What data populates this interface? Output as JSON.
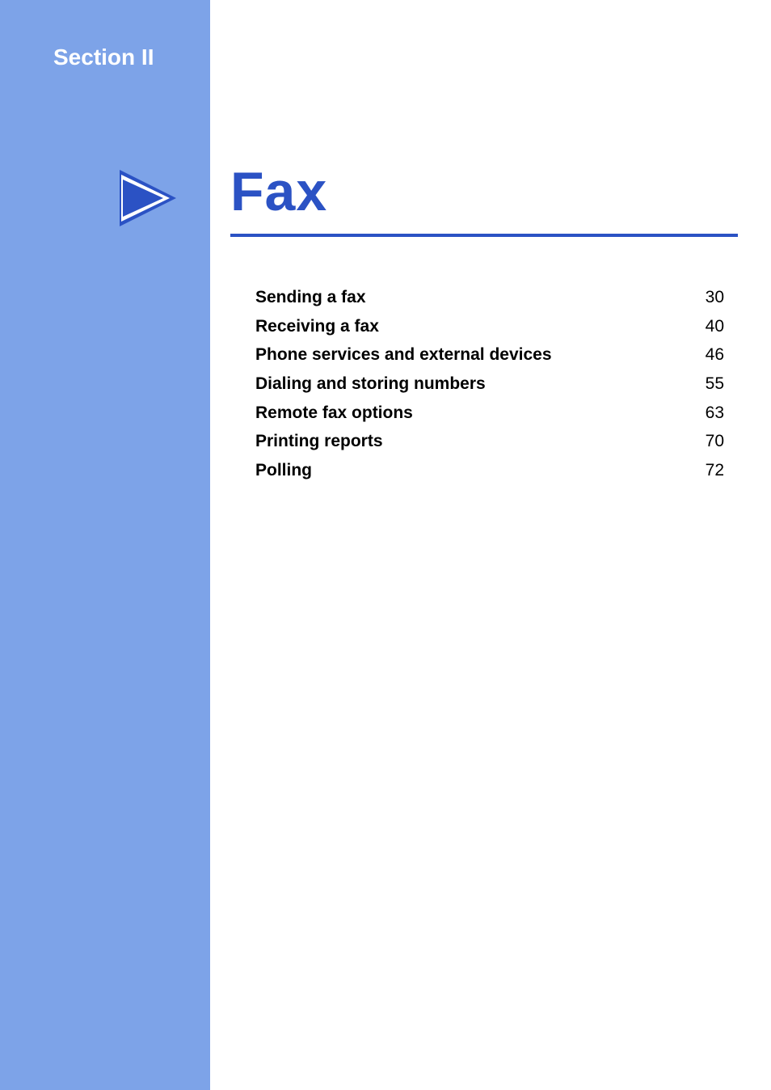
{
  "section_label": "Section II",
  "title": "Fax",
  "toc": [
    {
      "title": "Sending a fax",
      "page": "30"
    },
    {
      "title": "Receiving a fax",
      "page": "40"
    },
    {
      "title": "Phone services and external devices",
      "page": "46"
    },
    {
      "title": "Dialing and storing numbers",
      "page": "55"
    },
    {
      "title": "Remote fax options",
      "page": "63"
    },
    {
      "title": "Printing reports",
      "page": "70"
    },
    {
      "title": "Polling",
      "page": "72"
    }
  ],
  "colors": {
    "sidebar": "#7da3e8",
    "accent": "#2b52c4"
  }
}
